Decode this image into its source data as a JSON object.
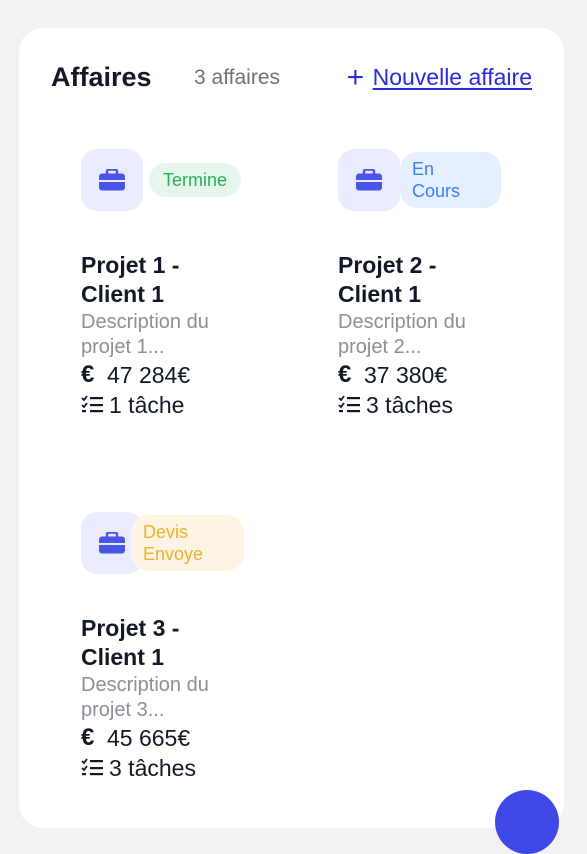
{
  "header": {
    "title": "Affaires",
    "count": "3 affaires",
    "new_label": "Nouvelle affaire",
    "plus_symbol": "+"
  },
  "projects": [
    {
      "status": "Termine",
      "name_line1": "Projet 1 -",
      "name_line2": "Client 1",
      "desc_line1": "Description du",
      "desc_line2": "projet 1...",
      "amount": "47 284€",
      "tasks": "1 tâche",
      "icon": "briefcase-icon"
    },
    {
      "status_line1": "En",
      "status_line2": "Cours",
      "name_line1": "Projet 2 -",
      "name_line2": "Client 1",
      "desc_line1": "Description du",
      "desc_line2": "projet 2...",
      "amount": "37 380€",
      "tasks": "3 tâches",
      "icon": "briefcase-icon"
    },
    {
      "status_line1": "Devis",
      "status_line2": "Envoye",
      "name_line1": "Projet 3 -",
      "name_line2": "Client 1",
      "desc_line1": "Description du",
      "desc_line2": "projet 3...",
      "amount": "45 665€",
      "tasks": "3 tâches",
      "icon": "briefcase-icon"
    }
  ],
  "symbols": {
    "euro": "€"
  },
  "colors": {
    "accent": "#2a2ae0",
    "icon_bg": "#e8ecfe",
    "status_done": "#26b05a",
    "status_progress": "#3a82e6",
    "status_quote": "#eab22d"
  }
}
